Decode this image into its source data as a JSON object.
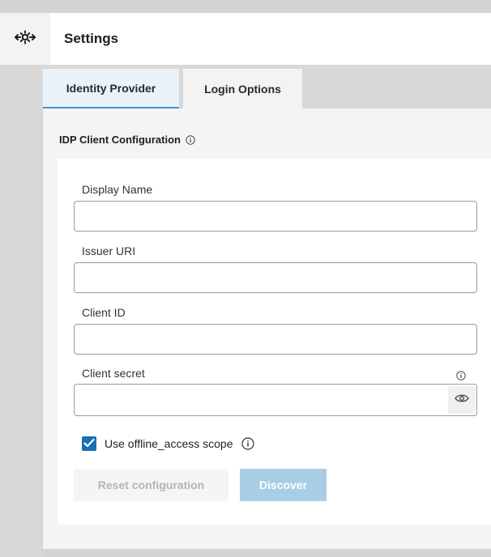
{
  "header": {
    "title": "Settings",
    "icon": "settings-gear-arrows-icon"
  },
  "tabs": [
    {
      "label": "Identity Provider",
      "active": true
    },
    {
      "label": "Login Options",
      "active": false
    }
  ],
  "section": {
    "title": "IDP Client Configuration",
    "icon": "info-icon"
  },
  "form": {
    "display_name": {
      "label": "Display Name",
      "value": "",
      "placeholder": ""
    },
    "issuer_uri": {
      "label": "Issuer URI",
      "value": "",
      "placeholder": ""
    },
    "client_id": {
      "label": "Client ID",
      "value": "",
      "placeholder": ""
    },
    "client_secret": {
      "label": "Client secret",
      "value": "",
      "placeholder": "",
      "icon": "eye-icon"
    },
    "offline_access": {
      "label": "Use offline_access scope",
      "checked": true
    }
  },
  "buttons": {
    "reset_label": "Reset configuration",
    "discover_label": "Discover"
  },
  "colors": {
    "accent": "#1a6fb5",
    "tab_active_bg": "#eaf2f9",
    "discover_bg": "#a9cde4",
    "disabled_text": "#b4b4b4"
  }
}
